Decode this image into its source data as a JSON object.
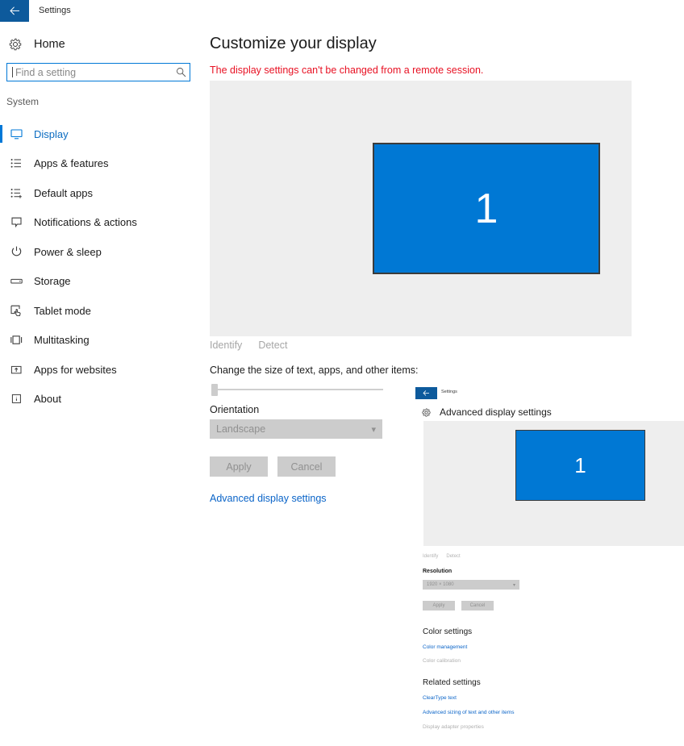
{
  "titlebar": {
    "back_icon": "arrow-left-icon",
    "app_title": "Settings"
  },
  "sidebar": {
    "home": {
      "icon": "gear-icon",
      "label": "Home"
    },
    "search": {
      "placeholder": "Find a setting",
      "value": "",
      "icon": "search-icon"
    },
    "group_label": "System",
    "items": [
      {
        "label": "Display",
        "icon": "monitor-icon",
        "active": true
      },
      {
        "label": "Apps & features",
        "icon": "list-icon",
        "active": false
      },
      {
        "label": "Default apps",
        "icon": "list-add-icon",
        "active": false
      },
      {
        "label": "Notifications & actions",
        "icon": "notification-icon",
        "active": false
      },
      {
        "label": "Power & sleep",
        "icon": "power-icon",
        "active": false
      },
      {
        "label": "Storage",
        "icon": "drive-icon",
        "active": false
      },
      {
        "label": "Tablet mode",
        "icon": "tablet-hand-icon",
        "active": false
      },
      {
        "label": "Multitasking",
        "icon": "multitask-icon",
        "active": false
      },
      {
        "label": "Apps for websites",
        "icon": "apps-web-icon",
        "active": false
      },
      {
        "label": "About",
        "icon": "info-icon",
        "active": false
      }
    ]
  },
  "main": {
    "title": "Customize your display",
    "warning": "The display settings can't be changed from a remote session.",
    "warning_color": "#e81123",
    "monitor": {
      "number": "1",
      "color": "#0078d4"
    },
    "identify_button": "Identify",
    "detect_button": "Detect",
    "scale_label": "Change the size of text, apps, and other items:",
    "orientation_label": "Orientation",
    "orientation_value": "Landscape",
    "apply_button": "Apply",
    "cancel_button": "Cancel",
    "advanced_link": "Advanced display settings"
  },
  "overlay": {
    "back_icon": "arrow-left-icon",
    "app_title": "Settings",
    "header_icon": "gear-icon",
    "header_title": "Advanced display settings",
    "monitor": {
      "number": "1",
      "color": "#0078d4"
    },
    "identify_button": "Identify",
    "detect_button": "Detect",
    "resolution_label": "Resolution",
    "resolution_value": "1920 × 1080",
    "apply_button": "Apply",
    "cancel_button": "Cancel",
    "color_settings_title": "Color settings",
    "color_management_link": "Color management",
    "color_calibration_link": "Color calibration",
    "related_settings_title": "Related settings",
    "cleartype_link": "ClearType text",
    "advanced_sizing_link": "Advanced sizing of text and other items",
    "display_adapter_link": "Display adapter properties"
  }
}
